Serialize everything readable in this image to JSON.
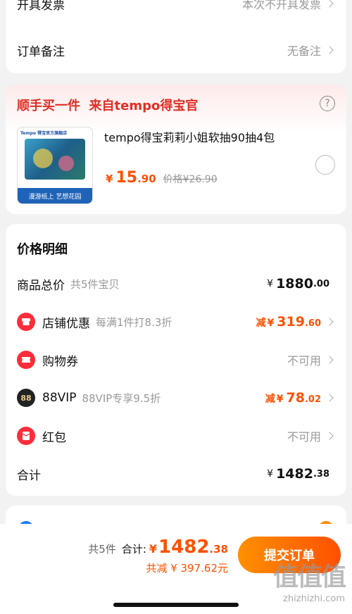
{
  "top": {
    "invoice_label": "开具发票",
    "invoice_value": "本次不开具发票",
    "remark_label": "订单备注",
    "remark_value": "无备注"
  },
  "promo": {
    "title": "顺手买一件  来自tempo得宝官",
    "product_name": "tempo得宝莉莉小姐软抽90抽4包",
    "price_symbol": "¥",
    "price_int": "15",
    "price_dec": ".90",
    "orig_price": "价格¥26.90",
    "img_brand": "Tempo 得宝官方旗舰店",
    "img_caption": "漫游纸上 艺想花园",
    "help_icon": "question-circle-icon"
  },
  "price_detail": {
    "title": "价格明细",
    "total_label": "商品总价",
    "total_sub": "共5件宝贝",
    "total_int": "1880",
    "total_dec": ".00",
    "shop_label": "店铺优惠",
    "shop_sub": "每满1件打8.3折",
    "shop_prefix": "减",
    "shop_int": "319",
    "shop_dec": ".60",
    "coupon_label": "购物券",
    "coupon_value": "不可用",
    "vip_label": "88VIP",
    "vip_sub": "88VIP专享9.5折",
    "vip_prefix": "减",
    "vip_int": "78",
    "vip_dec": ".02",
    "vip_badge": "88",
    "redpack_label": "红包",
    "redpack_value": "不可用",
    "sum_label": "合计",
    "sum_int": "1482",
    "sum_dec": ".38",
    "currency": "¥"
  },
  "bottom": {
    "count": "共5件",
    "total_label": "合计:",
    "total_int": "1482",
    "total_dec": ".38",
    "saving": "共减 ¥ 397.62元",
    "submit": "提交订单",
    "currency": "¥"
  },
  "watermark": {
    "text": "值值值",
    "url": "zhizhizhi.com"
  },
  "colors": {
    "accent": "#ff5000",
    "promo_title": "#e02e24",
    "promo_bg": "#fdecec"
  }
}
